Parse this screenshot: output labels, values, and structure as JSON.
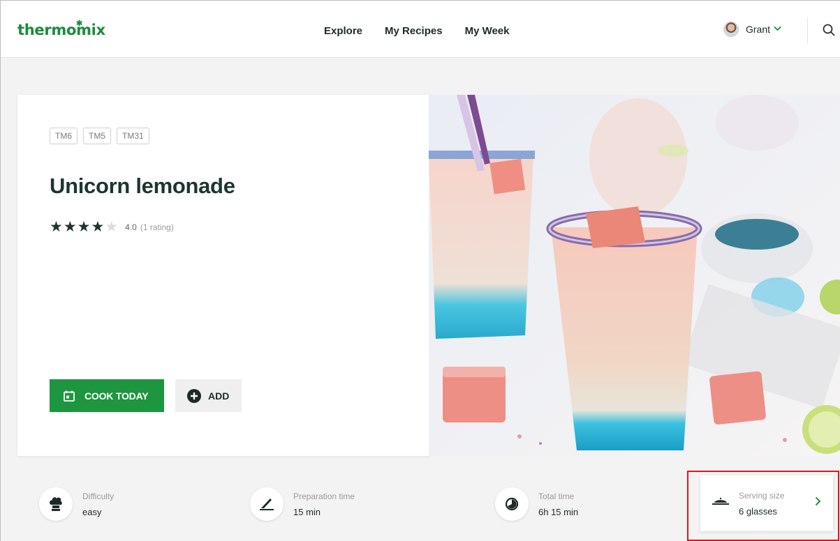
{
  "header": {
    "logo": "thermomix",
    "nav": [
      "Explore",
      "My Recipes",
      "My Week"
    ],
    "user_name": "Grant"
  },
  "recipe": {
    "tags": [
      "TM6",
      "TM5",
      "TM31"
    ],
    "title": "Unicorn lemonade",
    "rating_value": "4.0",
    "rating_count": "(1 rating)",
    "stars_filled": 4,
    "stars_total": 5
  },
  "actions": {
    "cook_today": "COOK TODAY",
    "add": "ADD"
  },
  "info": {
    "difficulty": {
      "label": "Difficulty",
      "value": "easy",
      "icon": "chef-hat-icon"
    },
    "prep_time": {
      "label": "Preparation time",
      "value": "15 min",
      "icon": "knife-icon"
    },
    "total_time": {
      "label": "Total time",
      "value": "6h 15 min",
      "icon": "timer-icon"
    },
    "serving": {
      "label": "Serving size",
      "value": "6 glasses",
      "icon": "dish-icon"
    }
  },
  "colors": {
    "brand_green": "#1d963f",
    "highlight_red": "#e0161e"
  }
}
